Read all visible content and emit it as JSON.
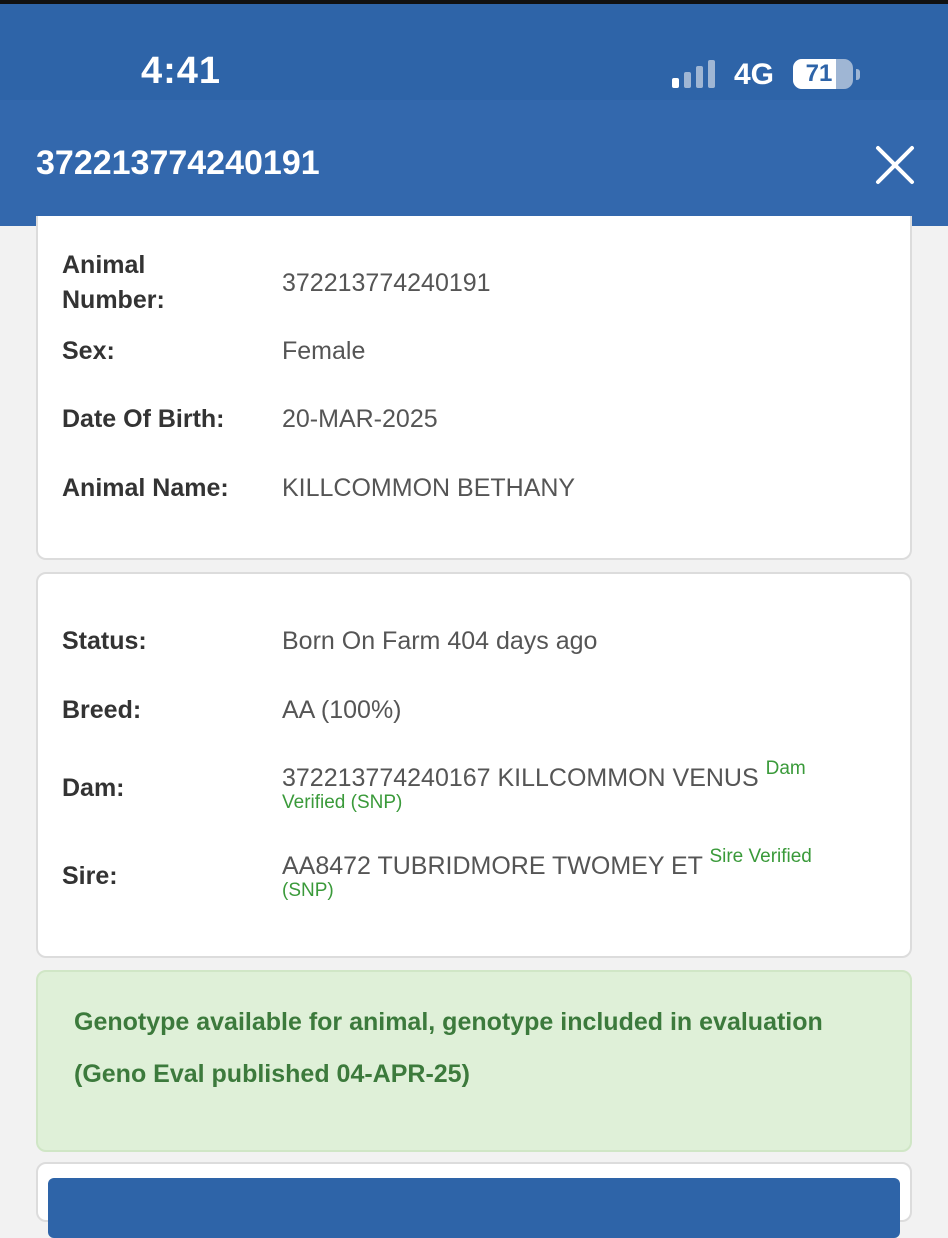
{
  "status_bar": {
    "time": "4:41",
    "network": "4G",
    "battery": "71",
    "battery_level": 0.71,
    "icons": {
      "signal": "cellular-signal-icon",
      "battery": "battery-icon"
    }
  },
  "header": {
    "title": "372213774240191",
    "close_icon": "close-icon"
  },
  "details": {
    "rows": [
      {
        "label": "Animal Number:",
        "value": "372213774240191"
      },
      {
        "label": "Sex:",
        "value": "Female"
      },
      {
        "label": "Date Of Birth:",
        "value": "20-MAR-2025"
      },
      {
        "label": "Animal Name:",
        "value": "KILLCOMMON BETHANY"
      }
    ]
  },
  "lineage": {
    "status": {
      "label": "Status:",
      "value": "Born On Farm 404 days ago"
    },
    "breed": {
      "label": "Breed:",
      "value": "AA (100%)"
    },
    "dam": {
      "label": "Dam:",
      "value": "372213774240167 KILLCOMMON VENUS",
      "verification_top": "Dam",
      "verification_bottom": "Verified (SNP)"
    },
    "sire": {
      "label": "Sire:",
      "value": "AA8472 TUBRIDMORE TWOMEY ET",
      "verification_top": "Sire Verified",
      "verification_bottom": "(SNP)"
    }
  },
  "genotype": {
    "line1": "Genotype available for animal, genotype included in evaluation",
    "line2": "(Geno Eval published 04-APR-25)"
  },
  "colors": {
    "header_blue": "#3368ad",
    "status_blue": "#2e64a8",
    "verified_green": "#3a9a3a",
    "alert_bg": "#dff0d8",
    "alert_text": "#3c7a3c"
  }
}
